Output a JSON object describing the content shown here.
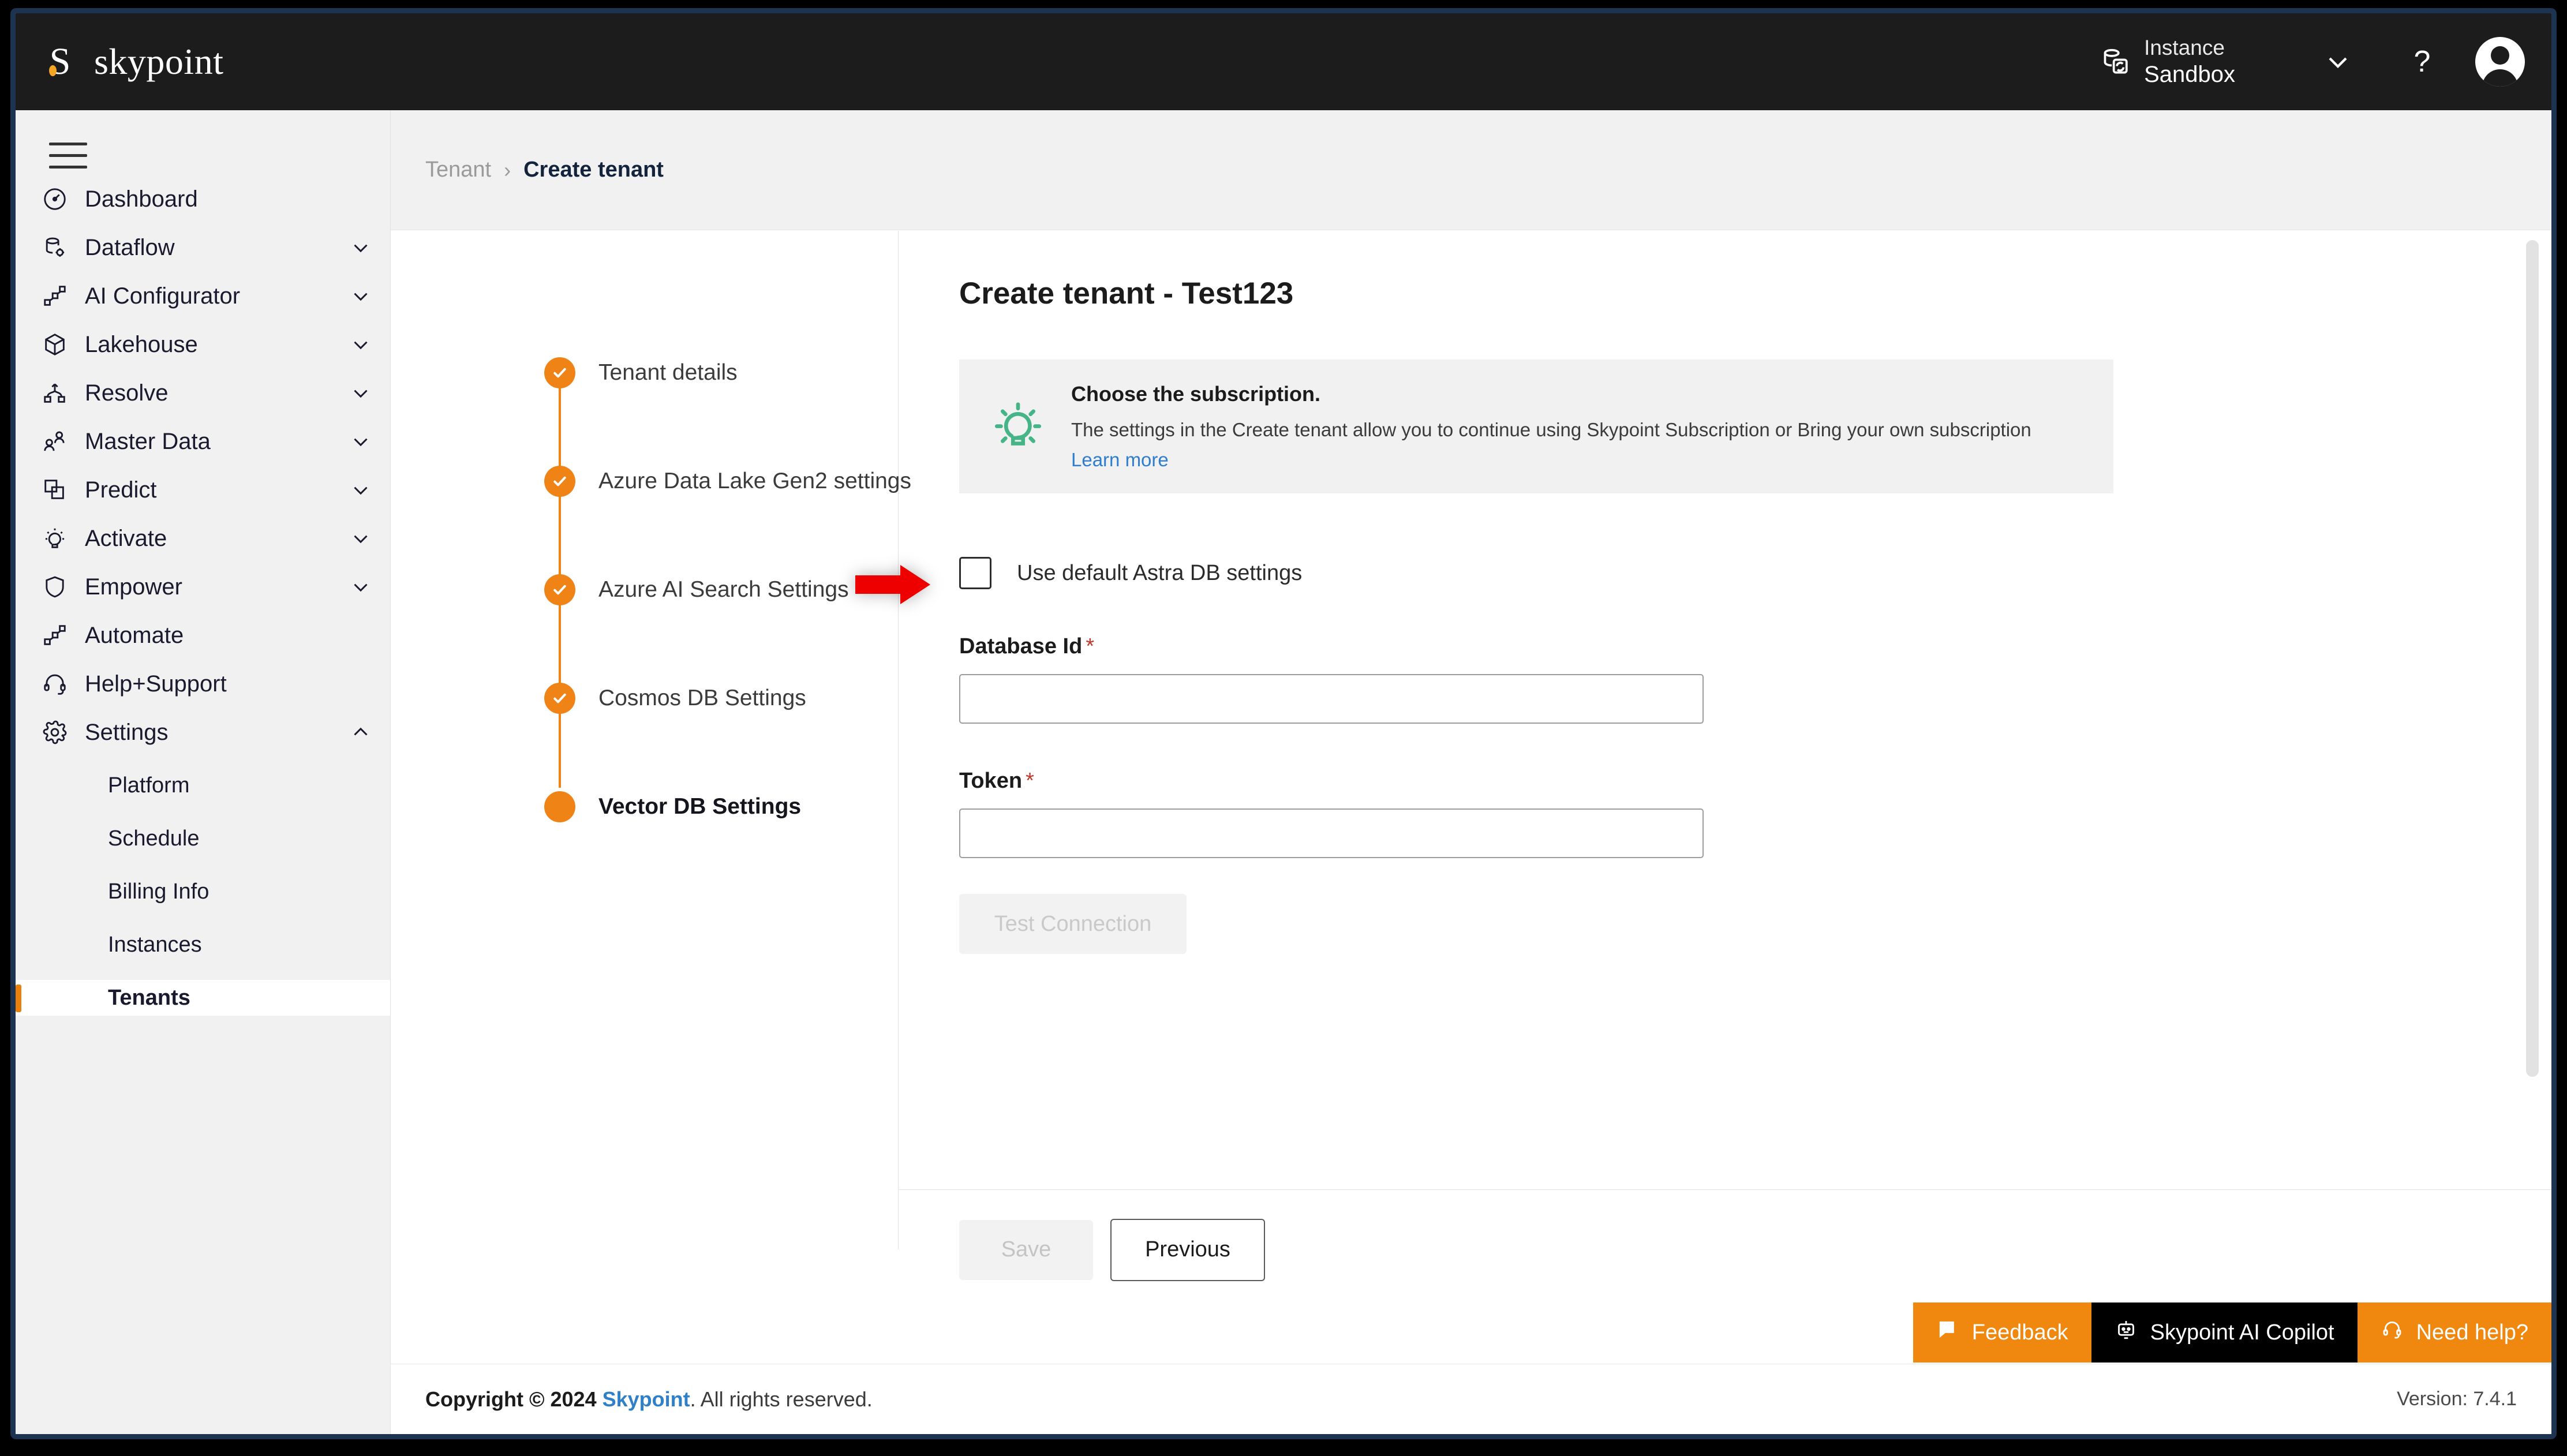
{
  "header": {
    "brand_mark": "S",
    "brand_name": "skypoint",
    "instance_label": "Instance",
    "instance_value": "Sandbox",
    "instance_icon": "instance-switch-icon",
    "chevron_icon": "chevron-down-icon",
    "help_icon": "?",
    "avatar_icon": "user-avatar-icon"
  },
  "sidebar": {
    "menu_icon": "hamburger-menu-icon",
    "items": [
      {
        "label": "Dashboard",
        "icon": "gauge-icon",
        "expandable": false,
        "caret": ""
      },
      {
        "label": "Dataflow",
        "icon": "database-gear-icon",
        "expandable": true,
        "caret": "chevron-down-icon"
      },
      {
        "label": "AI Configurator",
        "icon": "nodes-icon",
        "expandable": true,
        "caret": "chevron-down-icon"
      },
      {
        "label": "Lakehouse",
        "icon": "cube-icon",
        "expandable": true,
        "caret": "chevron-down-icon"
      },
      {
        "label": "Resolve",
        "icon": "merge-icon",
        "expandable": true,
        "caret": "chevron-down-icon"
      },
      {
        "label": "Master Data",
        "icon": "people-icon",
        "expandable": true,
        "caret": "chevron-down-icon"
      },
      {
        "label": "Predict",
        "icon": "layers-icon",
        "expandable": true,
        "caret": "chevron-down-icon"
      },
      {
        "label": "Activate",
        "icon": "lightbulb-icon",
        "expandable": true,
        "caret": "chevron-down-icon"
      },
      {
        "label": "Empower",
        "icon": "shield-icon",
        "expandable": true,
        "caret": "chevron-down-icon"
      },
      {
        "label": "Automate",
        "icon": "nodes-icon",
        "expandable": false,
        "caret": ""
      },
      {
        "label": "Help+Support",
        "icon": "headset-icon",
        "expandable": false,
        "caret": ""
      },
      {
        "label": "Settings",
        "icon": "gear-icon",
        "expandable": true,
        "caret": "chevron-up-icon"
      }
    ],
    "sub_items": [
      {
        "label": "Platform",
        "active": false
      },
      {
        "label": "Schedule",
        "active": false
      },
      {
        "label": "Billing Info",
        "active": false
      },
      {
        "label": "Instances",
        "active": false
      },
      {
        "label": "Tenants",
        "active": true
      }
    ]
  },
  "breadcrumb": {
    "parent": "Tenant",
    "separator": "›",
    "current": "Create tenant"
  },
  "stepper": {
    "steps": [
      {
        "label": "Tenant details",
        "state": "done"
      },
      {
        "label": "Azure Data Lake Gen2 settings",
        "state": "done"
      },
      {
        "label": "Azure AI Search Settings",
        "state": "done"
      },
      {
        "label": "Cosmos DB Settings",
        "state": "done"
      },
      {
        "label": "Vector DB Settings",
        "state": "current"
      }
    ]
  },
  "main": {
    "page_title": "Create tenant - Test123",
    "info": {
      "icon": "lightbulb-icon",
      "title": "Choose the subscription.",
      "description": "The settings in the Create tenant allow you to continue using Skypoint Subscription or Bring your own subscription",
      "link": "Learn more"
    },
    "checkbox": {
      "label": "Use default Astra DB settings",
      "checked": false
    },
    "fields": [
      {
        "label": "Database Id",
        "required": "*",
        "value": "",
        "placeholder": ""
      },
      {
        "label": "Token",
        "required": "*",
        "value": "",
        "placeholder": ""
      }
    ],
    "test_connection_label": "Test Connection"
  },
  "actions": {
    "save_label": "Save",
    "previous_label": "Previous"
  },
  "float_widgets": [
    {
      "label": "Feedback",
      "icon": "chat-bubble-icon",
      "style": "orange"
    },
    {
      "label": "Skypoint AI Copilot",
      "icon": "robot-icon",
      "style": "black"
    },
    {
      "label": "Need help?",
      "icon": "headset-icon",
      "style": "orange"
    }
  ],
  "footer": {
    "copyright_prefix": "Copyright © 2024 ",
    "brand": "Skypoint",
    "copyright_suffix": ". All rights reserved.",
    "version": "Version: 7.4.1"
  },
  "colors": {
    "accent_orange": "#ef8316",
    "brand_navy": "#1d3352",
    "topbar": "#1c1c1c",
    "sidebar_bg": "#f1f1f1",
    "info_green": "#45b486",
    "link_blue": "#2f7dd1",
    "required_red": "#c0392b",
    "annotation_red": "#ee0000"
  }
}
